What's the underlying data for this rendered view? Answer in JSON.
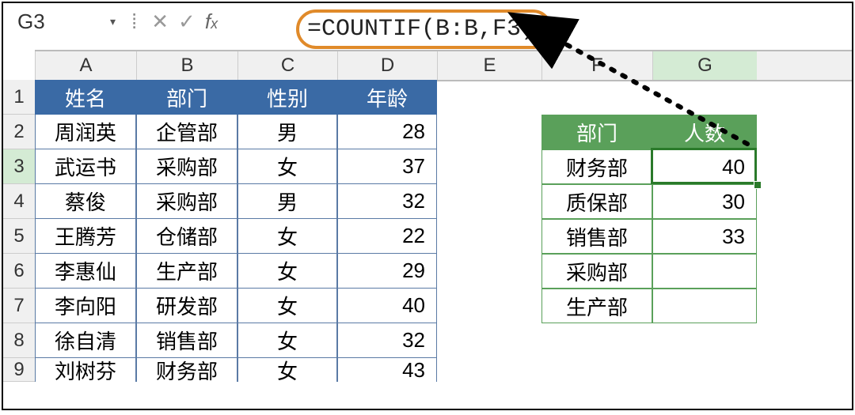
{
  "formula_bar": {
    "name_box": "G3",
    "formula": "=COUNTIF(B:B,F3)"
  },
  "columns": [
    "A",
    "B",
    "C",
    "D",
    "E",
    "F",
    "G"
  ],
  "rows": [
    "1",
    "2",
    "3",
    "4",
    "5",
    "6",
    "7",
    "8",
    "9"
  ],
  "table1": {
    "headers": [
      "姓名",
      "部门",
      "性别",
      "年龄"
    ],
    "data": [
      [
        "周润英",
        "企管部",
        "男",
        "28"
      ],
      [
        "武运书",
        "采购部",
        "女",
        "37"
      ],
      [
        "蔡俊",
        "采购部",
        "男",
        "32"
      ],
      [
        "王腾芳",
        "仓储部",
        "女",
        "22"
      ],
      [
        "李惠仙",
        "生产部",
        "女",
        "29"
      ],
      [
        "李向阳",
        "研发部",
        "女",
        "40"
      ],
      [
        "徐自清",
        "销售部",
        "女",
        "32"
      ],
      [
        "刘树芬",
        "财务部",
        "女",
        "43"
      ]
    ]
  },
  "table2": {
    "headers": [
      "部门",
      "人数"
    ],
    "data": [
      [
        "财务部",
        "40"
      ],
      [
        "质保部",
        "30"
      ],
      [
        "销售部",
        "33"
      ],
      [
        "采购部",
        ""
      ],
      [
        "生产部",
        ""
      ]
    ]
  },
  "selected_cell": "G3"
}
